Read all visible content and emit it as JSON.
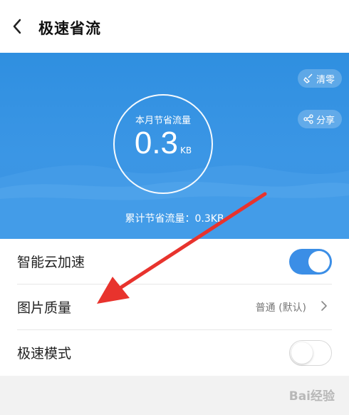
{
  "header": {
    "title": "极速省流"
  },
  "banner": {
    "month_label": "本月节省流量",
    "month_value": "0.3",
    "month_unit": "KB",
    "clear_label": "清零",
    "share_label": "分享",
    "total_text": "累计节省流量：0.3KB"
  },
  "settings": [
    {
      "label": "智能云加速",
      "toggle": "on"
    },
    {
      "label": "图片质量",
      "value": "普通 (默认)"
    },
    {
      "label": "极速模式",
      "toggle": "off"
    }
  ],
  "watermark": "Bai经验",
  "colors": {
    "accent": "#3b8ee6",
    "banner": "#3a93e3",
    "annotation_arrow": "#e8332d"
  }
}
